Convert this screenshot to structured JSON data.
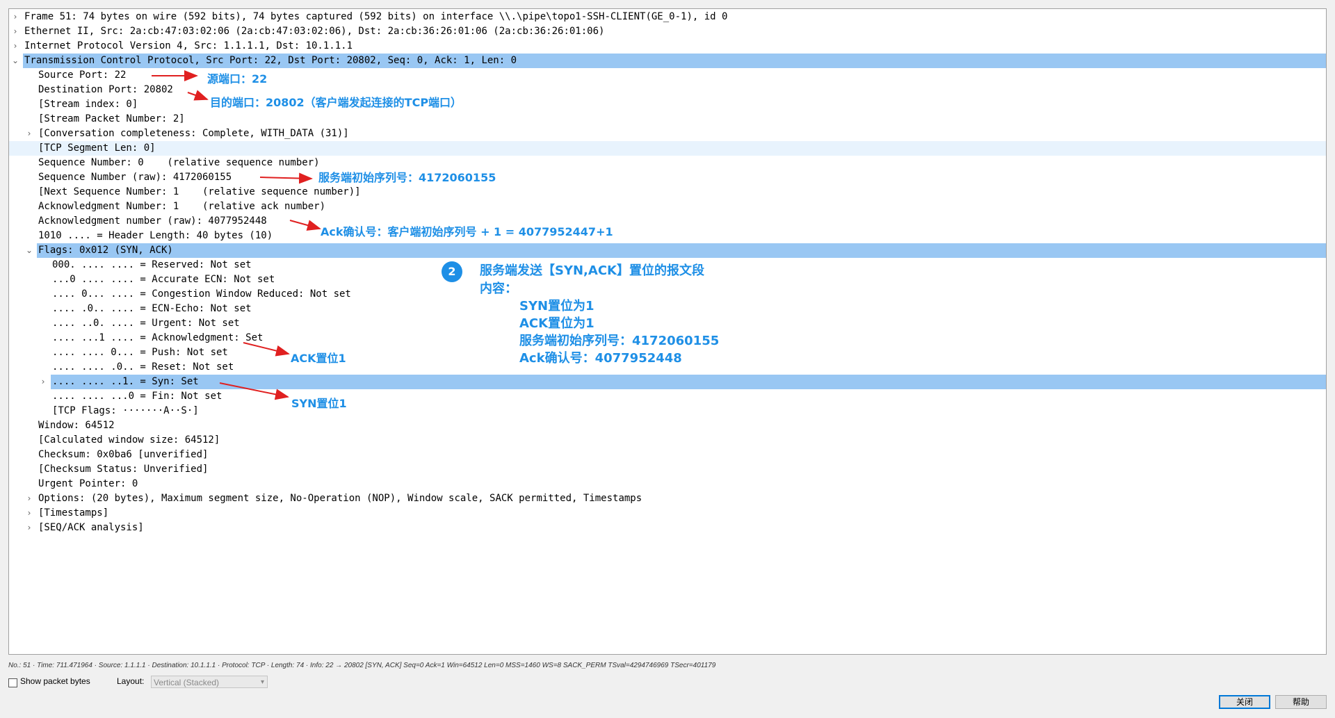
{
  "tree_rows": [
    {
      "text": "Frame 51: 74 bytes on wire (592 bits), 74 bytes captured (592 bits) on interface \\\\.\\pipe\\topo1-SSH-CLIENT(GE_0-1), id 0",
      "indent": 0,
      "arrow": "›",
      "state": "normal"
    },
    {
      "text": "Ethernet II, Src: 2a:cb:47:03:02:06 (2a:cb:47:03:02:06), Dst: 2a:cb:36:26:01:06 (2a:cb:36:26:01:06)",
      "indent": 0,
      "arrow": "›",
      "state": "normal"
    },
    {
      "text": "Internet Protocol Version 4, Src: 1.1.1.1, Dst: 10.1.1.1",
      "indent": 0,
      "arrow": "›",
      "state": "normal"
    },
    {
      "text": "Transmission Control Protocol, Src Port: 22, Dst Port: 20802, Seq: 0, Ack: 1, Len: 0",
      "indent": 0,
      "arrow": "⌄",
      "state": "selected"
    },
    {
      "text": "Source Port: 22",
      "indent": 1,
      "arrow": "",
      "state": "normal"
    },
    {
      "text": "Destination Port: 20802",
      "indent": 1,
      "arrow": "",
      "state": "normal"
    },
    {
      "text": "[Stream index: 0]",
      "indent": 1,
      "arrow": "",
      "state": "normal"
    },
    {
      "text": "[Stream Packet Number: 2]",
      "indent": 1,
      "arrow": "",
      "state": "normal"
    },
    {
      "text": "[Conversation completeness: Complete, WITH_DATA (31)]",
      "indent": 1,
      "arrow": "›",
      "state": "normal"
    },
    {
      "text": "[TCP Segment Len: 0]",
      "indent": 1,
      "arrow": "",
      "state": "highlight"
    },
    {
      "text": "Sequence Number: 0    (relative sequence number)",
      "indent": 1,
      "arrow": "",
      "state": "normal"
    },
    {
      "text": "Sequence Number (raw): 4172060155",
      "indent": 1,
      "arrow": "",
      "state": "normal"
    },
    {
      "text": "[Next Sequence Number: 1    (relative sequence number)]",
      "indent": 1,
      "arrow": "",
      "state": "normal"
    },
    {
      "text": "Acknowledgment Number: 1    (relative ack number)",
      "indent": 1,
      "arrow": "",
      "state": "normal"
    },
    {
      "text": "Acknowledgment number (raw): 4077952448",
      "indent": 1,
      "arrow": "",
      "state": "normal"
    },
    {
      "text": "1010 .... = Header Length: 40 bytes (10)",
      "indent": 1,
      "arrow": "",
      "state": "normal"
    },
    {
      "text": "Flags: 0x012 (SYN, ACK)",
      "indent": 1,
      "arrow": "⌄",
      "state": "selected"
    },
    {
      "text": "000. .... .... = Reserved: Not set",
      "indent": 2,
      "arrow": "",
      "state": "normal"
    },
    {
      "text": "...0 .... .... = Accurate ECN: Not set",
      "indent": 2,
      "arrow": "",
      "state": "normal"
    },
    {
      "text": ".... 0... .... = Congestion Window Reduced: Not set",
      "indent": 2,
      "arrow": "",
      "state": "normal"
    },
    {
      "text": ".... .0.. .... = ECN-Echo: Not set",
      "indent": 2,
      "arrow": "",
      "state": "normal"
    },
    {
      "text": ".... ..0. .... = Urgent: Not set",
      "indent": 2,
      "arrow": "",
      "state": "normal"
    },
    {
      "text": ".... ...1 .... = Acknowledgment: Set",
      "indent": 2,
      "arrow": "",
      "state": "normal"
    },
    {
      "text": ".... .... 0... = Push: Not set",
      "indent": 2,
      "arrow": "",
      "state": "normal"
    },
    {
      "text": ".... .... .0.. = Reset: Not set",
      "indent": 2,
      "arrow": "",
      "state": "normal"
    },
    {
      "text": ".... .... ..1. = Syn: Set",
      "indent": 2,
      "arrow": "›",
      "state": "selected"
    },
    {
      "text": ".... .... ...0 = Fin: Not set",
      "indent": 2,
      "arrow": "",
      "state": "normal"
    },
    {
      "text": "[TCP Flags: ·······A··S·]",
      "indent": 2,
      "arrow": "",
      "state": "normal"
    },
    {
      "text": "Window: 64512",
      "indent": 1,
      "arrow": "",
      "state": "normal"
    },
    {
      "text": "[Calculated window size: 64512]",
      "indent": 1,
      "arrow": "",
      "state": "normal"
    },
    {
      "text": "Checksum: 0x0ba6 [unverified]",
      "indent": 1,
      "arrow": "",
      "state": "normal"
    },
    {
      "text": "[Checksum Status: Unverified]",
      "indent": 1,
      "arrow": "",
      "state": "normal"
    },
    {
      "text": "Urgent Pointer: 0",
      "indent": 1,
      "arrow": "",
      "state": "normal"
    },
    {
      "text": "Options: (20 bytes), Maximum segment size, No-Operation (NOP), Window scale, SACK permitted, Timestamps",
      "indent": 1,
      "arrow": "›",
      "state": "normal"
    },
    {
      "text": "[Timestamps]",
      "indent": 1,
      "arrow": "›",
      "state": "normal"
    },
    {
      "text": "[SEQ/ACK analysis]",
      "indent": 1,
      "arrow": "›",
      "state": "normal"
    }
  ],
  "annotations": {
    "source_port": "源端口：22",
    "dest_port": "目的端口：20802（客户端发起连接的TCP端口）",
    "seq_raw": "服务端初始序列号：4172060155",
    "ack_raw": "Ack确认号：客户端初始序列号 + 1 = 4077952447+1",
    "ack_flag": "ACK置位1",
    "syn_flag": "SYN置位1",
    "badge": "2",
    "summary_title": "服务端发送【SYN,ACK】置位的报文段",
    "summary_content": "内容：",
    "summary_lines": [
      "SYN置位为1",
      "ACK置位为1",
      "服务端初始序列号：4172060155",
      "Ack确认号：4077952448"
    ]
  },
  "colors": {
    "annotation": "#1e8fe6",
    "arrow": "#e02020",
    "selection": "#99c7f3"
  },
  "status_bar": "No.: 51 · Time: 711.471964 · Source: 1.1.1.1 · Destination: 10.1.1.1 · Protocol: TCP · Length: 74 · Info: 22 → 20802 [SYN, ACK] Seq=0 Ack=1 Win=64512 Len=0 MSS=1460 WS=8 SACK_PERM TSval=4294746969 TSecr=401179",
  "bottom": {
    "show_bytes_label": "Show packet bytes",
    "show_bytes_checked": false,
    "layout_label": "Layout:",
    "layout_value": "Vertical (Stacked)",
    "close_label": "关闭",
    "help_label": "帮助"
  }
}
